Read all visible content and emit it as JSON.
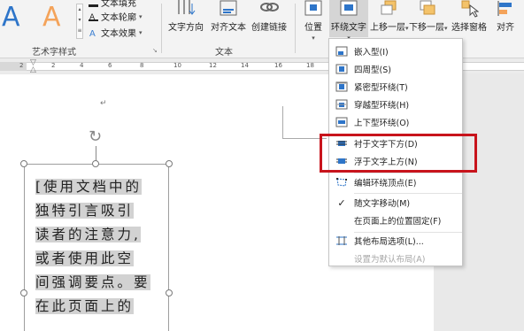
{
  "ribbon": {
    "art_group_label": "艺术字样式",
    "text_group_label": "文本",
    "text_outline": "文本轮廓",
    "text_effect": "文本效果",
    "text_fill_partial": "文本填充",
    "text_direction": "文字方向",
    "align_text": "对齐文本",
    "create_link": "创建链接",
    "position": "位置",
    "wrap_text": "环绕文字",
    "bring_forward": "上移一层",
    "send_backward": "下移一层",
    "selection_pane": "选择窗格",
    "align": "对齐"
  },
  "ruler": {
    "numbers": [
      "2",
      "2",
      "4",
      "6",
      "8",
      "10",
      "12",
      "14",
      "16",
      "18"
    ]
  },
  "document": {
    "paragraph_mark": "↵",
    "textbox_lines": [
      "[使用文档中的",
      "独特引言吸引",
      "读者的注意力,",
      "或者使用此空",
      "间强调要点。要",
      "在此页面上的"
    ]
  },
  "menu": {
    "items": [
      {
        "label": "嵌入型(I)",
        "icon": "inline-wrap-icon",
        "disabled": false
      },
      {
        "label": "四周型(S)",
        "icon": "square-wrap-icon",
        "disabled": false
      },
      {
        "label": "紧密型环绕(T)",
        "icon": "tight-wrap-icon",
        "disabled": false
      },
      {
        "label": "穿越型环绕(H)",
        "icon": "through-wrap-icon",
        "disabled": false
      },
      {
        "label": "上下型环绕(O)",
        "icon": "top-bottom-wrap-icon",
        "disabled": false
      },
      {
        "label": "衬于文字下方(D)",
        "icon": "behind-text-icon",
        "disabled": false
      },
      {
        "label": "浮于文字上方(N)",
        "icon": "in-front-text-icon",
        "disabled": false
      },
      {
        "label": "编辑环绕顶点(E)",
        "icon": "edit-points-icon",
        "disabled": false
      },
      {
        "label": "随文字移动(M)",
        "icon": "check-icon",
        "disabled": false
      },
      {
        "label": "在页面上的位置固定(F)",
        "icon": "none",
        "disabled": false
      },
      {
        "label": "其他布局选项(L)...",
        "icon": "layout-options-icon",
        "disabled": false
      },
      {
        "label": "设置为默认布局(A)",
        "icon": "none",
        "disabled": true
      }
    ]
  },
  "colors": {
    "highlight_red": "#c8141c",
    "art_blue": "#2e75c9",
    "art_orange": "#f4a35a"
  }
}
